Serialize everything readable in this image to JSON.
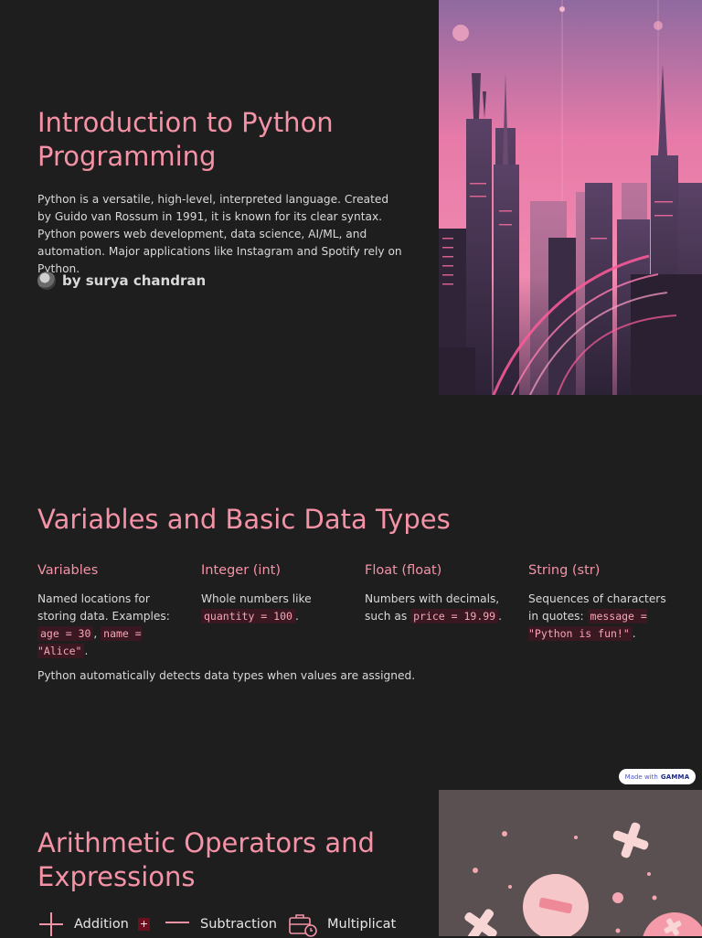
{
  "slide1": {
    "title": "Introduction to Python Programming",
    "description": "Python is a versatile, high-level, interpreted language. Created by Guido van Rossum in 1991, it is known for its clear syntax. Python powers web development, data science, AI/ML, and automation. Major applications like Instagram and Spotify rely on Python.",
    "author": "by surya chandran",
    "image_icon": "neon-city-illustration"
  },
  "slide2": {
    "title": "Variables and Basic Data Types",
    "columns": [
      {
        "title": "Variables",
        "text_before": "Named locations for storing data. Examples: ",
        "code1": "age = 30",
        "sep": ", ",
        "code2": "name = \"Alice\"",
        "text_after": "."
      },
      {
        "title": "Integer (int)",
        "text_before": "Whole numbers like ",
        "code1": "quantity = 100",
        "text_after": "."
      },
      {
        "title": "Float (float)",
        "text_before": "Numbers with decimals, such as ",
        "code1": "price = 19.99",
        "text_after": "."
      },
      {
        "title": "String (str)",
        "text_before": "Sequences of characters in quotes: ",
        "code1": "message = \"Python is fun!\"",
        "text_after": "."
      }
    ],
    "note": "Python automatically detects data types when values are assigned."
  },
  "badge": {
    "prefix": "Made with",
    "brand": "GAMMA"
  },
  "slide3": {
    "title": "Arithmetic Operators and Expressions",
    "operators": [
      {
        "icon": "plus-icon",
        "label": "Addition",
        "symbol": "+"
      },
      {
        "icon": "minus-icon",
        "label": "Subtraction",
        "symbol": ""
      },
      {
        "icon": "briefcase-clock-icon",
        "label": "Multiplicat",
        "symbol": ""
      }
    ],
    "image_icon": "math-symbols-illustration"
  },
  "colors": {
    "background": "#1f1e1f",
    "accent": "#f492a6",
    "code_bg": "#3a1822"
  }
}
